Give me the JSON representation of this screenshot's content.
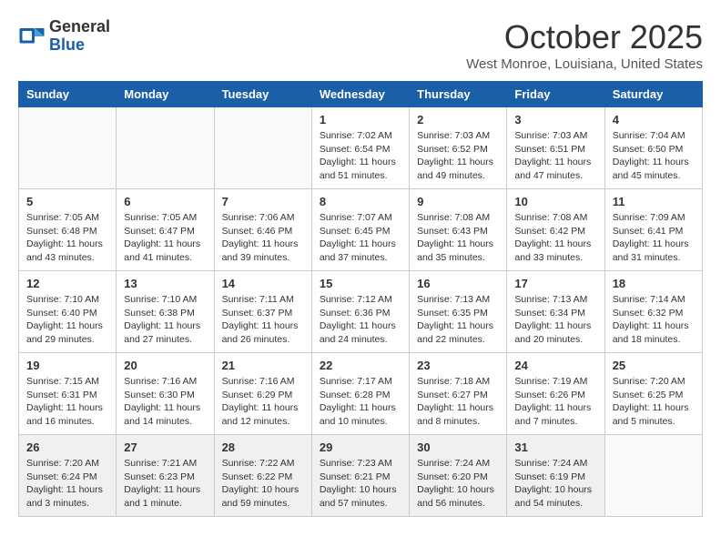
{
  "logo": {
    "general": "General",
    "blue": "Blue"
  },
  "title": "October 2025",
  "location": "West Monroe, Louisiana, United States",
  "days_of_week": [
    "Sunday",
    "Monday",
    "Tuesday",
    "Wednesday",
    "Thursday",
    "Friday",
    "Saturday"
  ],
  "weeks": [
    [
      {
        "day": "",
        "info": ""
      },
      {
        "day": "",
        "info": ""
      },
      {
        "day": "",
        "info": ""
      },
      {
        "day": "1",
        "info": "Sunrise: 7:02 AM\nSunset: 6:54 PM\nDaylight: 11 hours\nand 51 minutes."
      },
      {
        "day": "2",
        "info": "Sunrise: 7:03 AM\nSunset: 6:52 PM\nDaylight: 11 hours\nand 49 minutes."
      },
      {
        "day": "3",
        "info": "Sunrise: 7:03 AM\nSunset: 6:51 PM\nDaylight: 11 hours\nand 47 minutes."
      },
      {
        "day": "4",
        "info": "Sunrise: 7:04 AM\nSunset: 6:50 PM\nDaylight: 11 hours\nand 45 minutes."
      }
    ],
    [
      {
        "day": "5",
        "info": "Sunrise: 7:05 AM\nSunset: 6:48 PM\nDaylight: 11 hours\nand 43 minutes."
      },
      {
        "day": "6",
        "info": "Sunrise: 7:05 AM\nSunset: 6:47 PM\nDaylight: 11 hours\nand 41 minutes."
      },
      {
        "day": "7",
        "info": "Sunrise: 7:06 AM\nSunset: 6:46 PM\nDaylight: 11 hours\nand 39 minutes."
      },
      {
        "day": "8",
        "info": "Sunrise: 7:07 AM\nSunset: 6:45 PM\nDaylight: 11 hours\nand 37 minutes."
      },
      {
        "day": "9",
        "info": "Sunrise: 7:08 AM\nSunset: 6:43 PM\nDaylight: 11 hours\nand 35 minutes."
      },
      {
        "day": "10",
        "info": "Sunrise: 7:08 AM\nSunset: 6:42 PM\nDaylight: 11 hours\nand 33 minutes."
      },
      {
        "day": "11",
        "info": "Sunrise: 7:09 AM\nSunset: 6:41 PM\nDaylight: 11 hours\nand 31 minutes."
      }
    ],
    [
      {
        "day": "12",
        "info": "Sunrise: 7:10 AM\nSunset: 6:40 PM\nDaylight: 11 hours\nand 29 minutes."
      },
      {
        "day": "13",
        "info": "Sunrise: 7:10 AM\nSunset: 6:38 PM\nDaylight: 11 hours\nand 27 minutes."
      },
      {
        "day": "14",
        "info": "Sunrise: 7:11 AM\nSunset: 6:37 PM\nDaylight: 11 hours\nand 26 minutes."
      },
      {
        "day": "15",
        "info": "Sunrise: 7:12 AM\nSunset: 6:36 PM\nDaylight: 11 hours\nand 24 minutes."
      },
      {
        "day": "16",
        "info": "Sunrise: 7:13 AM\nSunset: 6:35 PM\nDaylight: 11 hours\nand 22 minutes."
      },
      {
        "day": "17",
        "info": "Sunrise: 7:13 AM\nSunset: 6:34 PM\nDaylight: 11 hours\nand 20 minutes."
      },
      {
        "day": "18",
        "info": "Sunrise: 7:14 AM\nSunset: 6:32 PM\nDaylight: 11 hours\nand 18 minutes."
      }
    ],
    [
      {
        "day": "19",
        "info": "Sunrise: 7:15 AM\nSunset: 6:31 PM\nDaylight: 11 hours\nand 16 minutes."
      },
      {
        "day": "20",
        "info": "Sunrise: 7:16 AM\nSunset: 6:30 PM\nDaylight: 11 hours\nand 14 minutes."
      },
      {
        "day": "21",
        "info": "Sunrise: 7:16 AM\nSunset: 6:29 PM\nDaylight: 11 hours\nand 12 minutes."
      },
      {
        "day": "22",
        "info": "Sunrise: 7:17 AM\nSunset: 6:28 PM\nDaylight: 11 hours\nand 10 minutes."
      },
      {
        "day": "23",
        "info": "Sunrise: 7:18 AM\nSunset: 6:27 PM\nDaylight: 11 hours\nand 8 minutes."
      },
      {
        "day": "24",
        "info": "Sunrise: 7:19 AM\nSunset: 6:26 PM\nDaylight: 11 hours\nand 7 minutes."
      },
      {
        "day": "25",
        "info": "Sunrise: 7:20 AM\nSunset: 6:25 PM\nDaylight: 11 hours\nand 5 minutes."
      }
    ],
    [
      {
        "day": "26",
        "info": "Sunrise: 7:20 AM\nSunset: 6:24 PM\nDaylight: 11 hours\nand 3 minutes."
      },
      {
        "day": "27",
        "info": "Sunrise: 7:21 AM\nSunset: 6:23 PM\nDaylight: 11 hours\nand 1 minute."
      },
      {
        "day": "28",
        "info": "Sunrise: 7:22 AM\nSunset: 6:22 PM\nDaylight: 10 hours\nand 59 minutes."
      },
      {
        "day": "29",
        "info": "Sunrise: 7:23 AM\nSunset: 6:21 PM\nDaylight: 10 hours\nand 57 minutes."
      },
      {
        "day": "30",
        "info": "Sunrise: 7:24 AM\nSunset: 6:20 PM\nDaylight: 10 hours\nand 56 minutes."
      },
      {
        "day": "31",
        "info": "Sunrise: 7:24 AM\nSunset: 6:19 PM\nDaylight: 10 hours\nand 54 minutes."
      },
      {
        "day": "",
        "info": ""
      }
    ]
  ]
}
